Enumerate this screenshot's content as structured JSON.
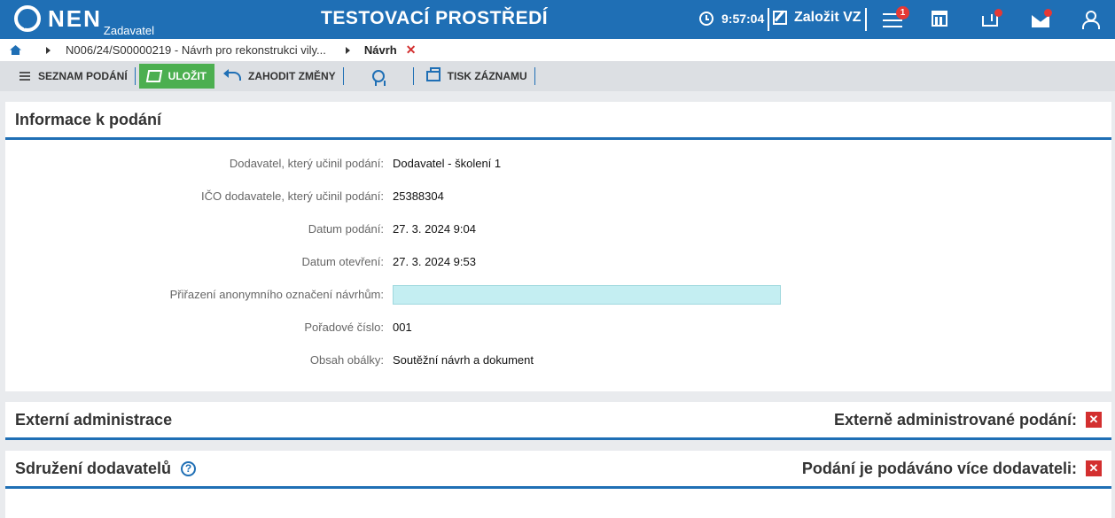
{
  "header": {
    "logo_text": "NEN",
    "logo_sub": "Zadavatel",
    "env_title": "TESTOVACÍ PROSTŘEDÍ",
    "clock": "9:57:04",
    "create_label": "Založit VZ",
    "menu_badge": "1",
    "icons": [
      "clock-icon",
      "edit-icon",
      "menu-icon",
      "calculator-icon",
      "inbox-icon",
      "mail-icon",
      "user-icon"
    ],
    "badge_color": "#e53935",
    "brand_color": "#1f6fb5"
  },
  "breadcrumb": {
    "items": [
      "N006/24/S00000219 - Návrh pro rekonstrukci vily...",
      "Návrh"
    ]
  },
  "toolbar": {
    "list_label": "SEZNAM PODÁNÍ",
    "save_label": "ULOŽIT",
    "discard_label": "ZAHODIT ZMĚNY",
    "print_label": "TISK ZÁZNAMU",
    "save_color": "#4caf50"
  },
  "info_panel": {
    "title": "Informace k podání",
    "rows": [
      {
        "label": "Dodavatel, který učinil podání:",
        "value": "Dodavatel - školení 1"
      },
      {
        "label": "IČO dodavatele, který učinil podání:",
        "value": "25388304"
      },
      {
        "label": "Datum podání:",
        "value": "27. 3. 2024 9:04"
      },
      {
        "label": "Datum otevření:",
        "value": "27. 3. 2024 9:53"
      },
      {
        "label": "Přiřazení anonymního označení návrhům:",
        "value": ""
      },
      {
        "label": "Pořadové číslo:",
        "value": "001"
      },
      {
        "label": "Obsah obálky:",
        "value": "Soutěžní návrh a dokument"
      }
    ]
  },
  "external_panel": {
    "title": "Externí administrace",
    "right_label": "Externě administrované podání:"
  },
  "association_panel": {
    "title": "Sdružení dodavatelů",
    "right_label": "Podání je podáváno více dodavateli:"
  }
}
